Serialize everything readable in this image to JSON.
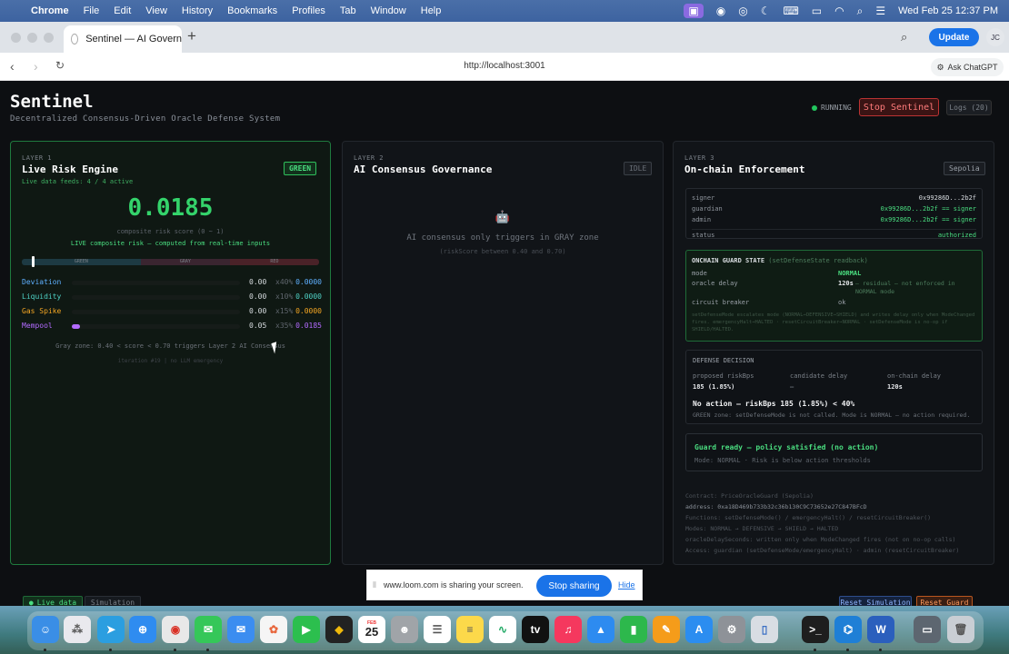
{
  "menubar": {
    "app": "Chrome",
    "items": [
      "File",
      "Edit",
      "View",
      "History",
      "Bookmarks",
      "Profiles",
      "Tab",
      "Window",
      "Help"
    ],
    "clock": "Wed Feb 25  12:37 PM"
  },
  "browser": {
    "tab_title": "Sentinel — AI Govern",
    "update_label": "Update",
    "avatar_initials": "JC",
    "url": "http://localhost:3001",
    "ask_chatgpt": "Ask ChatGPT"
  },
  "header": {
    "title": "Sentinel",
    "subtitle": "Decentralized Consensus-Driven Oracle Defense System",
    "status": "RUNNING",
    "stop_label": "Stop Sentinel",
    "logs_label": "Logs (20)"
  },
  "layer1": {
    "layer": "LAYER 1",
    "title": "Live Risk Engine",
    "badge": "GREEN",
    "feeds": "Live data feeds: 4 / 4 active",
    "score": "0.0185",
    "score_label": "composite risk score (0 ~ 1)",
    "live_label": "LIVE composite risk — computed from real-time inputs",
    "gauge": {
      "marker": 0.0185,
      "zones": [
        "GREEN",
        "GRAY",
        "RED"
      ]
    },
    "metrics": [
      {
        "name": "Deviation",
        "value": "0.00",
        "weight": "x40%",
        "result": "0.0000",
        "level": 0.0,
        "color": "#5fb0ff"
      },
      {
        "name": "Liquidity",
        "value": "0.00",
        "weight": "x10%",
        "result": "0.0000",
        "level": 0.0,
        "color": "#4fd1c5"
      },
      {
        "name": "Gas Spike",
        "value": "0.00",
        "weight": "x15%",
        "result": "0.0000",
        "level": 0.0,
        "color": "#f5a623"
      },
      {
        "name": "Mempool",
        "value": "0.05",
        "weight": "x35%",
        "result": "0.0185",
        "level": 0.05,
        "color": "#b36bff"
      }
    ],
    "gray_note": "Gray zone: 0.40 < score < 0.70 triggers Layer 2 AI Consensus",
    "iter_note": "iteration #19 | no LLM emergency"
  },
  "layer2": {
    "layer": "LAYER 2",
    "title": "AI Consensus Governance",
    "badge": "IDLE",
    "robot": "🤖",
    "message": "AI consensus only triggers in GRAY zone",
    "sub": "(riskScore between 0.40 and 0.70)"
  },
  "layer3": {
    "layer": "LAYER 3",
    "title": "On-chain Enforcement",
    "badge": "Sepolia",
    "roles": [
      {
        "k": "signer",
        "v": "0x99286D...2b2f"
      },
      {
        "k": "guardian",
        "v": "0x99286D...2b2f == signer"
      },
      {
        "k": "admin",
        "v": "0x99286D...2b2f == signer"
      }
    ],
    "status_key": "status",
    "status_val": "authorized",
    "guard": {
      "head": "ONCHAIN GUARD STATE",
      "head_note": "(setDefenseState readback)",
      "mode_k": "mode",
      "mode_v": "NORMAL",
      "delay_k": "oracle delay",
      "delay_v": "120s",
      "delay_note": "— residual — not enforced in NORMAL mode",
      "cb_k": "circuit breaker",
      "cb_v": "ok",
      "desc": "setDefenseMode escalates mode (NORMAL→DEFENSIVE→SHIELD) and writes delay only when ModeChanged fires. emergencyHalt→HALTED · resetCircuitBreaker→NORMAL · setDefenseMode is no-op if SHIELD/HALTED."
    },
    "decision": {
      "head": "DEFENSE DECISION",
      "cols": [
        {
          "k": "proposed riskBps",
          "v": "185 (1.85%)"
        },
        {
          "k": "candidate delay",
          "v": "—"
        },
        {
          "k": "on-chain delay",
          "v": "120s"
        }
      ],
      "main": "No action — riskBps 185 (1.85%) < 40%",
      "sub": "GREEN zone: setDefenseMode is not called. Mode is NORMAL — no action required."
    },
    "ready": {
      "title": "Guard ready — policy satisfied (no action)",
      "sub": "Mode: NORMAL · Risk is below action thresholds"
    },
    "contract": [
      "Contract: PriceOracleGuard (Sepolia)",
      "address: 0xa18D469b733b32c36b130C9C73652e27C847BFcD",
      "Functions: setDefenseMode() / emergencyHalt() / resetCircuitBreaker()",
      "Modes: NORMAL → DEFENSIVE → SHIELD → HALTED",
      "oracleDelaySeconds: written only when ModeChanged fires (not on no-op calls)",
      "Access: guardian (setDefenseMode/emergencyHalt) · admin (resetCircuitBreaker)"
    ]
  },
  "footer": {
    "live": "Live data",
    "simulation": "Simulation",
    "reset_sim": "Reset Simulation",
    "reset_guard": "Reset Guard"
  },
  "share": {
    "message": "www.loom.com is sharing your screen.",
    "stop": "Stop sharing",
    "hide": "Hide"
  },
  "dock": {
    "calendar_month": "FEB",
    "calendar_day": "25"
  }
}
